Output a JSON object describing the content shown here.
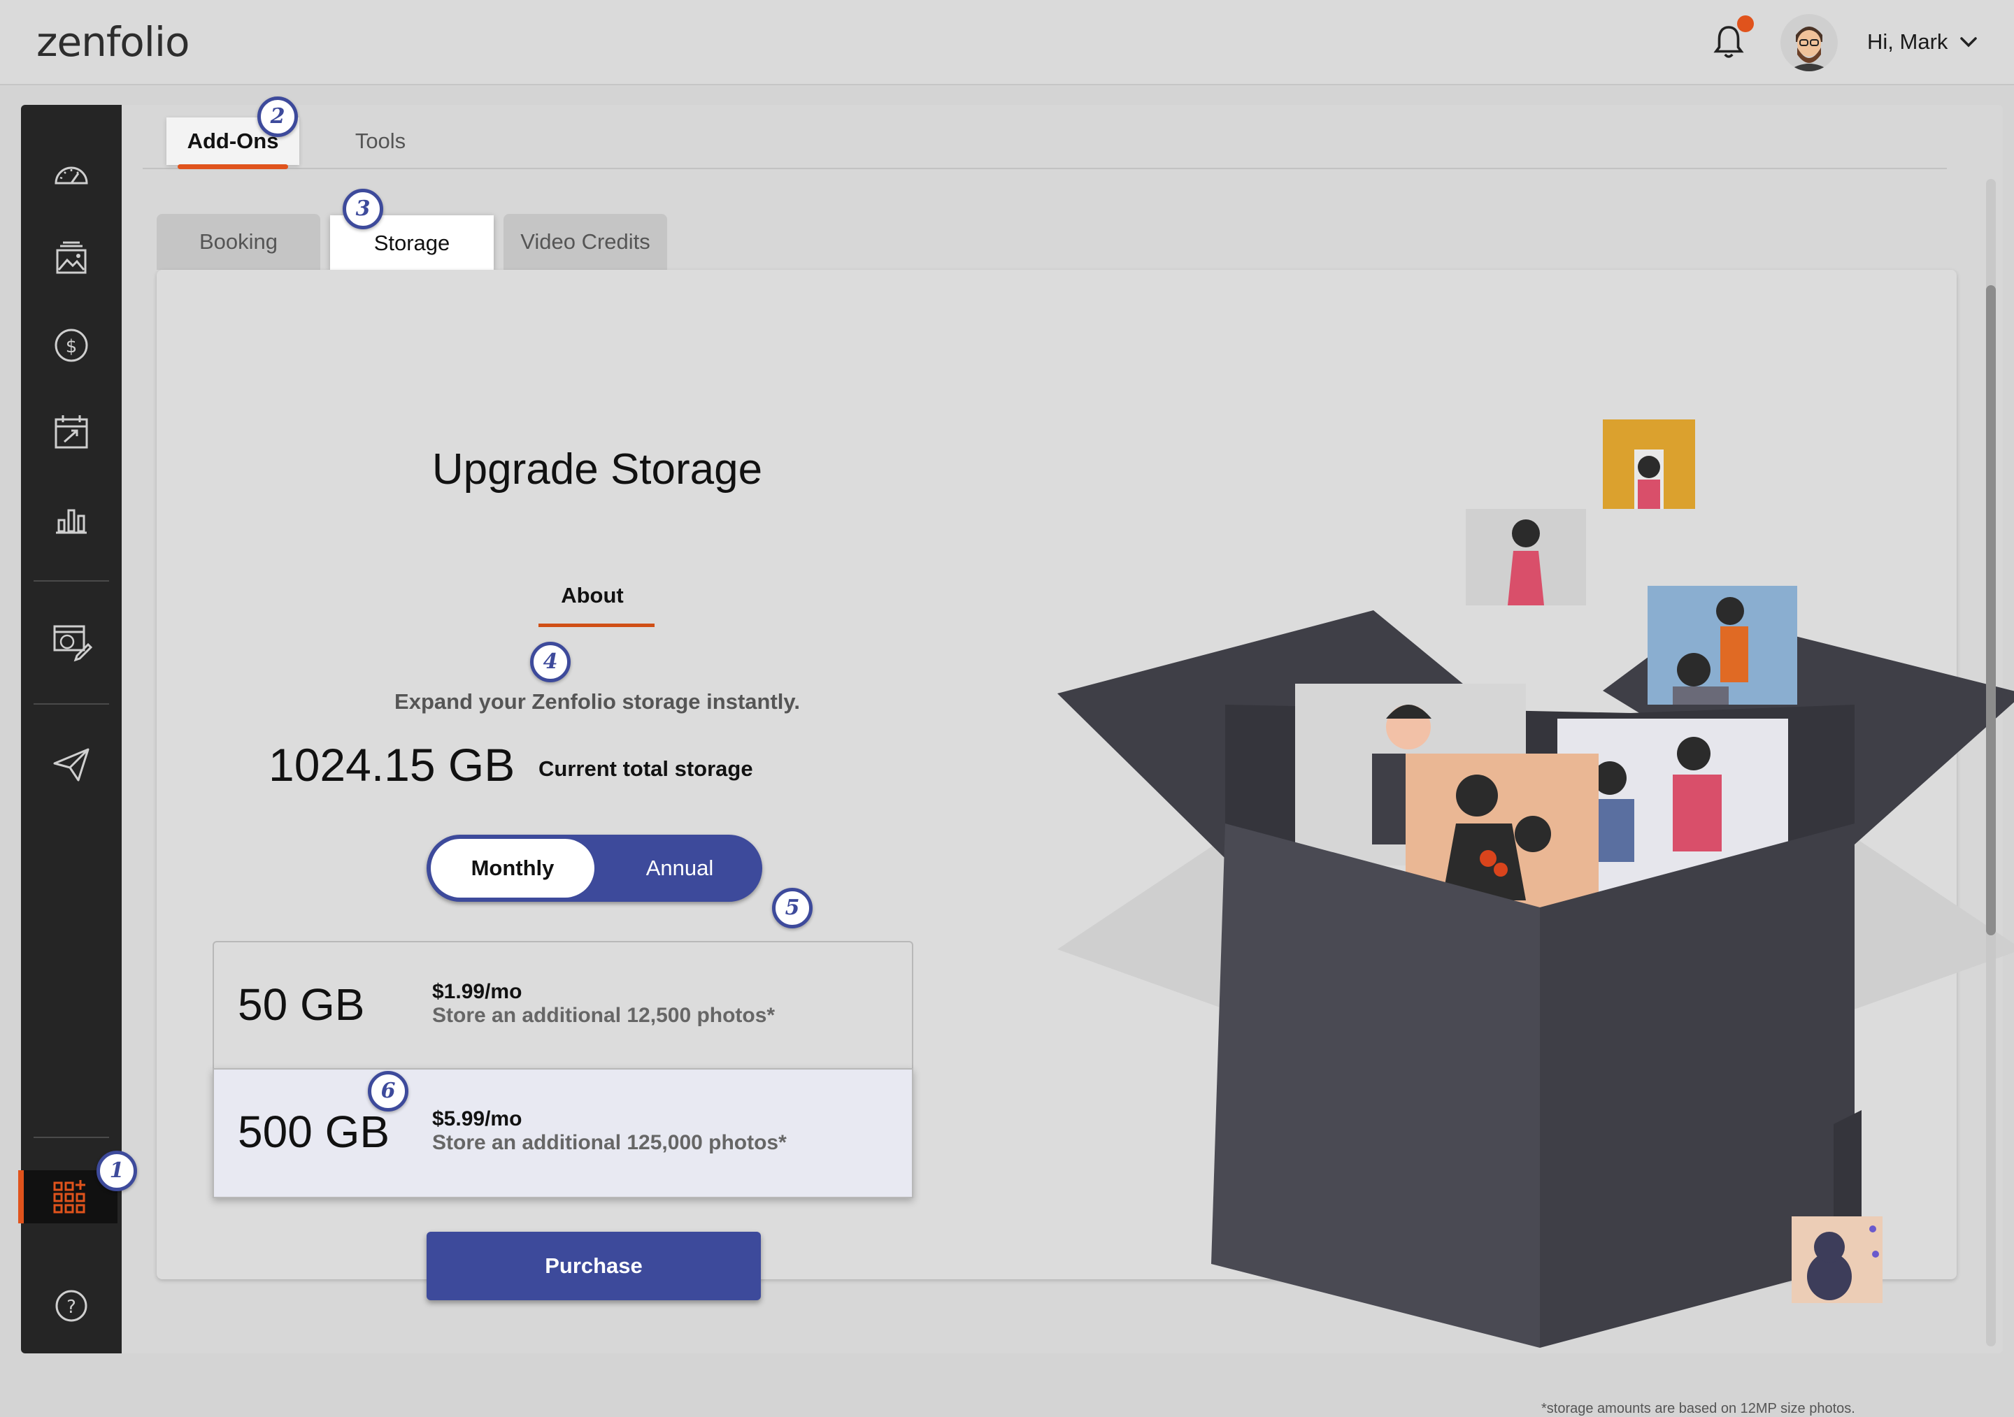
{
  "header": {
    "logo": "zenfolio",
    "greeting": "Hi, Mark"
  },
  "tabs": {
    "top": [
      "Add-Ons",
      "Tools"
    ],
    "sub": [
      "Booking",
      "Storage",
      "Video Credits"
    ]
  },
  "storage": {
    "title": "Upgrade Storage",
    "about": "About",
    "tagline": "Expand your Zenfolio storage instantly.",
    "current_value": "1024.15 GB",
    "current_label": "Current total storage",
    "billing": {
      "monthly": "Monthly",
      "annual": "Annual",
      "selected": "Monthly"
    },
    "plans": [
      {
        "size": "50 GB",
        "price": "$1.99/mo",
        "desc": "Store an additional 12,500 photos*"
      },
      {
        "size": "500 GB",
        "price": "$5.99/mo",
        "desc": "Store an additional 125,000 photos*",
        "selected": true
      }
    ],
    "purchase": "Purchase",
    "footnote": "*storage amounts are based on 12MP size photos."
  },
  "markers": [
    "1",
    "2",
    "3",
    "4",
    "5",
    "6"
  ],
  "colors": {
    "accent": "#e0531c",
    "primary": "#3d4a9b",
    "sidebar": "#252525"
  },
  "sidebar_icons": [
    "dashboard-icon",
    "gallery-icon",
    "sales-icon",
    "calendar-icon",
    "stats-icon",
    "website-edit-icon",
    "send-icon",
    "apps-icon",
    "help-icon"
  ]
}
